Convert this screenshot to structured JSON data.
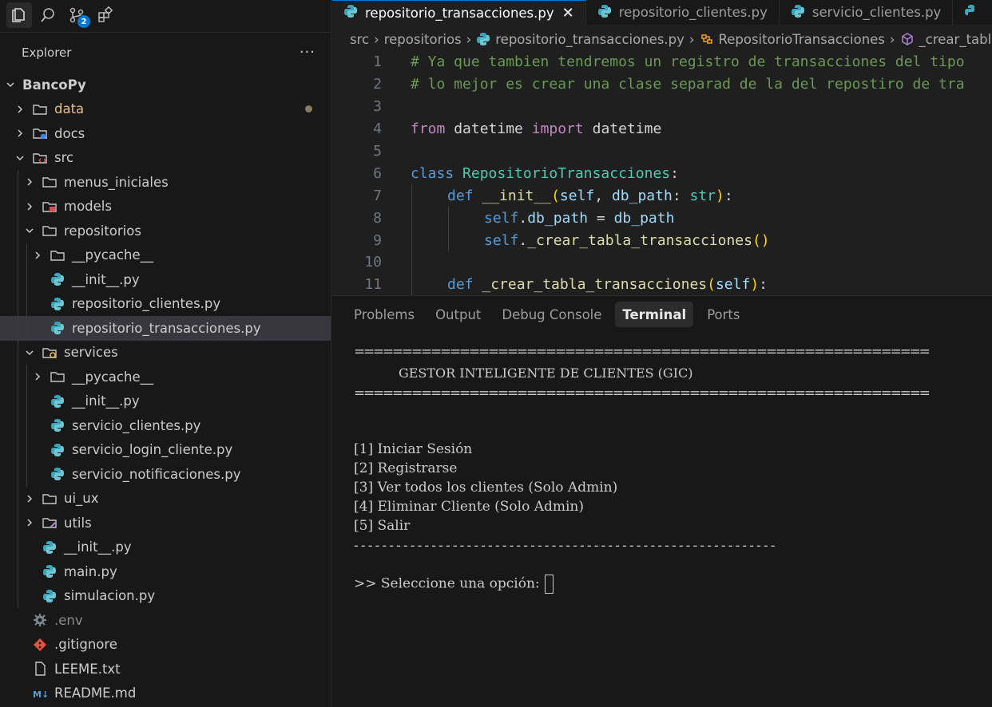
{
  "activity": {
    "scm_badge": "2"
  },
  "explorer": {
    "title": "Explorer",
    "more": "···",
    "tree": [
      {
        "label": "BancoPy",
        "depth": 0,
        "kind": "root",
        "chevron": "down"
      },
      {
        "label": "data",
        "depth": 1,
        "kind": "folder",
        "chevron": "right",
        "modified": true
      },
      {
        "label": "docs",
        "depth": 1,
        "kind": "folder-docs",
        "chevron": "right"
      },
      {
        "label": "src",
        "depth": 1,
        "kind": "folder-src",
        "chevron": "down"
      },
      {
        "label": "menus_iniciales",
        "depth": 2,
        "kind": "folder",
        "chevron": "right"
      },
      {
        "label": "models",
        "depth": 2,
        "kind": "folder-models",
        "chevron": "right"
      },
      {
        "label": "repositorios",
        "depth": 2,
        "kind": "folder",
        "chevron": "down"
      },
      {
        "label": "__pycache__",
        "depth": 3,
        "kind": "folder",
        "chevron": "right"
      },
      {
        "label": "__init__.py",
        "depth": 3,
        "kind": "python"
      },
      {
        "label": "repositorio_clientes.py",
        "depth": 3,
        "kind": "python"
      },
      {
        "label": "repositorio_transacciones.py",
        "depth": 3,
        "kind": "python",
        "selected": true
      },
      {
        "label": "services",
        "depth": 2,
        "kind": "folder-services",
        "chevron": "down"
      },
      {
        "label": "__pycache__",
        "depth": 3,
        "kind": "folder",
        "chevron": "right"
      },
      {
        "label": "__init__.py",
        "depth": 3,
        "kind": "python"
      },
      {
        "label": "servicio_clientes.py",
        "depth": 3,
        "kind": "python"
      },
      {
        "label": "servicio_login_cliente.py",
        "depth": 3,
        "kind": "python"
      },
      {
        "label": "servicio_notificaciones.py",
        "depth": 3,
        "kind": "python"
      },
      {
        "label": "ui_ux",
        "depth": 2,
        "kind": "folder",
        "chevron": "right"
      },
      {
        "label": "utils",
        "depth": 2,
        "kind": "folder-utils",
        "chevron": "right"
      },
      {
        "label": "__init__.py",
        "depth": 2,
        "kind": "python"
      },
      {
        "label": "main.py",
        "depth": 2,
        "kind": "python"
      },
      {
        "label": "simulacion.py",
        "depth": 2,
        "kind": "python"
      },
      {
        "label": ".env",
        "depth": 1,
        "kind": "env",
        "dim": true
      },
      {
        "label": ".gitignore",
        "depth": 1,
        "kind": "git"
      },
      {
        "label": "LEEME.txt",
        "depth": 1,
        "kind": "txt"
      },
      {
        "label": "README.md",
        "depth": 1,
        "kind": "md"
      }
    ]
  },
  "tabs": [
    {
      "label": "repositorio_transacciones.py",
      "active": true,
      "close": "✕"
    },
    {
      "label": "repositorio_clientes.py",
      "active": false
    },
    {
      "label": "servicio_clientes.py",
      "active": false
    }
  ],
  "breadcrumb": {
    "src": "src",
    "repositorios": "repositorios",
    "file": "repositorio_transacciones.py",
    "class": "RepositorioTransacciones",
    "method": "_crear_tabla"
  },
  "code": {
    "l1": "# Ya que tambien tendremos un registro de transacciones del tipo",
    "l2": "# lo mejor es crear una clase separad de la del repostiro de tra",
    "l4_from": "from",
    "l4_mod": "datetime",
    "l4_import": "import",
    "l4_name": "datetime",
    "l6_class": "class",
    "l6_name": "RepositorioTransacciones",
    "l6_colon": ":",
    "l7_def": "def",
    "l7_fn": "__init__",
    "l7_open": "(",
    "l7_self": "self",
    "l7_mid": ", ",
    "l7_param": "db_path",
    "l7_rest": ": ",
    "l7_type": "str",
    "l7_close": ")",
    "l7_colon": ":",
    "l8_self": "self",
    "l8_dot": ".",
    "l8_attr": "db_path",
    "l8_eq": " = ",
    "l8_val": "db_path",
    "l9_self": "self",
    "l9_dot": ".",
    "l9_fn": "_crear_tabla_transacciones",
    "l9_par": "()",
    "l11_def": "def",
    "l11_fn": "_crear_tabla_transacciones",
    "l11_open": "(",
    "l11_self": "self",
    "l11_close": ")",
    "l11_colon": ":"
  },
  "panel": {
    "tabs": [
      "Problems",
      "Output",
      "Debug Console",
      "Terminal",
      "Ports"
    ],
    "active_tab": "Terminal"
  },
  "terminal": {
    "rule_top": "============================================================",
    "title": "           GESTOR INTELIGENTE DE CLIENTES (GIC)",
    "rule_mid": "============================================================",
    "opt1": "[1] Iniciar Sesión",
    "opt2": "[2] Registrarse",
    "opt3": "[3] Ver todos los clientes (Solo Admin)",
    "opt4": "[4] Eliminar Cliente (Solo Admin)",
    "opt5": "[5] Salir",
    "rule_bottom": "------------------------------------------------------------",
    "prompt": ">> Seleccione una opción:"
  }
}
